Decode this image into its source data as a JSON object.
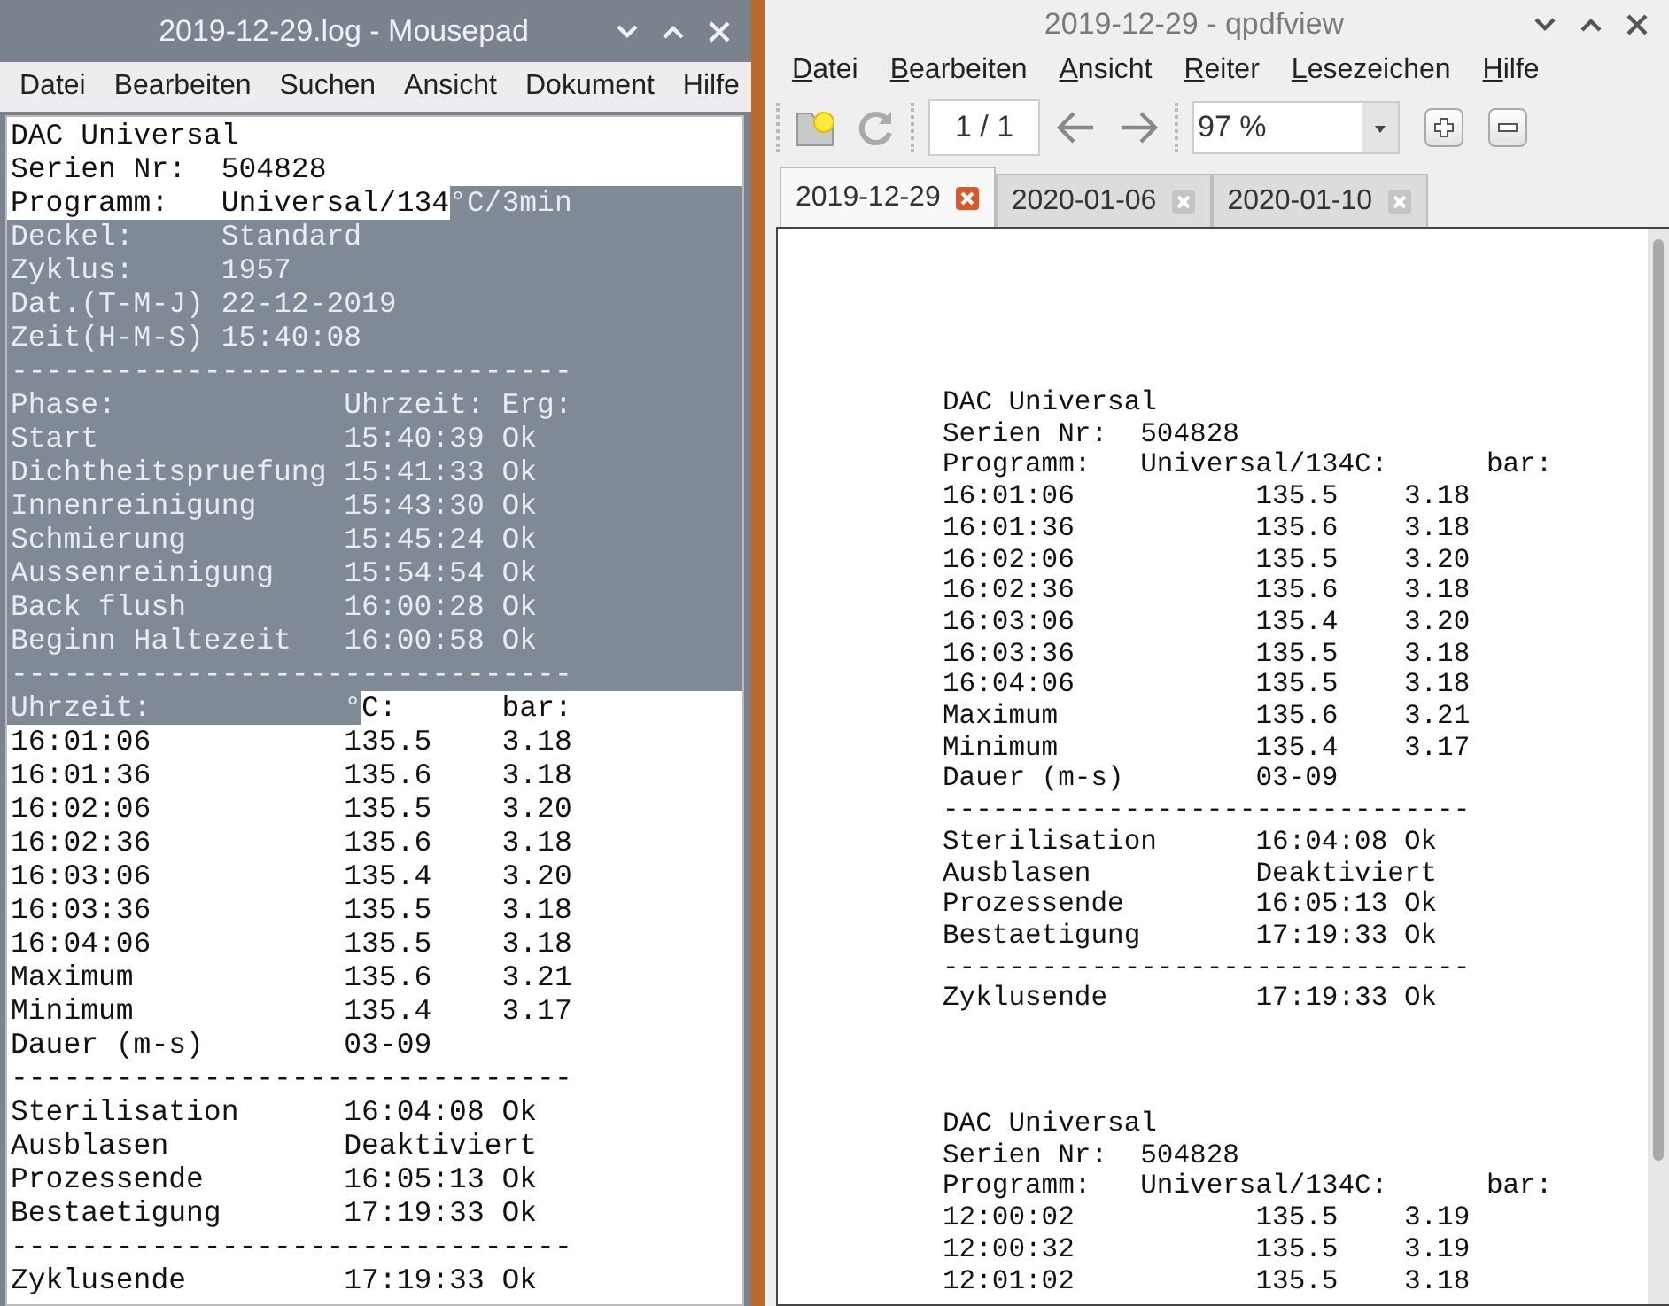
{
  "editor_window": {
    "title": "2019-12-29.log - Mousepad",
    "menu": [
      "Datei",
      "Bearbeiten",
      "Suchen",
      "Ansicht",
      "Dokument",
      "Hilfe"
    ],
    "lines": [
      {
        "parts": [
          {
            "text": "DAC Universal",
            "selected": false
          }
        ]
      },
      {
        "parts": [
          {
            "text": "Serien Nr:  504828",
            "selected": false
          }
        ]
      },
      {
        "parts": [
          {
            "text": "Programm:   Universal/134",
            "selected": false
          },
          {
            "text": "°C/3min",
            "selected": true
          }
        ]
      },
      {
        "parts": [
          {
            "text": "Deckel:     Standard",
            "selected": true
          }
        ]
      },
      {
        "parts": [
          {
            "text": "Zyklus:     1957",
            "selected": true
          }
        ]
      },
      {
        "parts": [
          {
            "text": "Dat.(T-M-J) 22-12-2019",
            "selected": true
          }
        ]
      },
      {
        "parts": [
          {
            "text": "Zeit(H-M-S) 15:40:08",
            "selected": true
          }
        ]
      },
      {
        "parts": [
          {
            "text": "--------------------------------",
            "selected": true
          }
        ]
      },
      {
        "parts": [
          {
            "text": "Phase:             Uhrzeit: Erg:",
            "selected": true
          }
        ]
      },
      {
        "parts": [
          {
            "text": "Start              15:40:39 Ok",
            "selected": true
          }
        ]
      },
      {
        "parts": [
          {
            "text": "Dichtheitspruefung 15:41:33 Ok",
            "selected": true
          }
        ]
      },
      {
        "parts": [
          {
            "text": "Innenreinigung     15:43:30 Ok",
            "selected": true
          }
        ]
      },
      {
        "parts": [
          {
            "text": "Schmierung         15:45:24 Ok",
            "selected": true
          }
        ]
      },
      {
        "parts": [
          {
            "text": "Aussenreinigung    15:54:54 Ok",
            "selected": true
          }
        ]
      },
      {
        "parts": [
          {
            "text": "Back flush         16:00:28 Ok",
            "selected": true
          }
        ]
      },
      {
        "parts": [
          {
            "text": "Beginn Haltezeit   16:00:58 Ok",
            "selected": true
          }
        ]
      },
      {
        "parts": [
          {
            "text": "--------------------------------",
            "selected": true
          }
        ]
      },
      {
        "parts": [
          {
            "text": "Uhrzeit:           °",
            "selected": true
          },
          {
            "text": "C:      bar:",
            "selected": false
          }
        ]
      },
      {
        "parts": [
          {
            "text": "16:01:06           135.5    3.18",
            "selected": false
          }
        ]
      },
      {
        "parts": [
          {
            "text": "16:01:36           135.6    3.18",
            "selected": false
          }
        ]
      },
      {
        "parts": [
          {
            "text": "16:02:06           135.5    3.20",
            "selected": false
          }
        ]
      },
      {
        "parts": [
          {
            "text": "16:02:36           135.6    3.18",
            "selected": false
          }
        ]
      },
      {
        "parts": [
          {
            "text": "16:03:06           135.4    3.20",
            "selected": false
          }
        ]
      },
      {
        "parts": [
          {
            "text": "16:03:36           135.5    3.18",
            "selected": false
          }
        ]
      },
      {
        "parts": [
          {
            "text": "16:04:06           135.5    3.18",
            "selected": false
          }
        ]
      },
      {
        "parts": [
          {
            "text": "Maximum            135.6    3.21",
            "selected": false
          }
        ]
      },
      {
        "parts": [
          {
            "text": "Minimum            135.4    3.17",
            "selected": false
          }
        ]
      },
      {
        "parts": [
          {
            "text": "Dauer (m-s)        03-09",
            "selected": false
          }
        ]
      },
      {
        "parts": [
          {
            "text": "--------------------------------",
            "selected": false
          }
        ]
      },
      {
        "parts": [
          {
            "text": "Sterilisation      16:04:08 Ok",
            "selected": false
          }
        ]
      },
      {
        "parts": [
          {
            "text": "Ausblasen          Deaktiviert",
            "selected": false
          }
        ]
      },
      {
        "parts": [
          {
            "text": "Prozessende        16:05:13 Ok",
            "selected": false
          }
        ]
      },
      {
        "parts": [
          {
            "text": "Bestaetigung       17:19:33 Ok",
            "selected": false
          }
        ]
      },
      {
        "parts": [
          {
            "text": "--------------------------------",
            "selected": false
          }
        ]
      },
      {
        "parts": [
          {
            "text": "Zyklusende         17:19:33 Ok",
            "selected": false
          }
        ]
      }
    ]
  },
  "viewer_window": {
    "title": "2019-12-29 - qpdfview",
    "menu": [
      "Datei",
      "Bearbeiten",
      "Ansicht",
      "Reiter",
      "Lesezeichen",
      "Hilfe"
    ],
    "page_field": "1 / 1",
    "zoom_field": "97 %",
    "tabs": [
      {
        "label": "2019-12-29",
        "selected": true
      },
      {
        "label": "2020-01-06",
        "selected": false
      },
      {
        "label": "2020-01-10",
        "selected": false
      }
    ],
    "blocks": [
      {
        "lines": [
          "DAC Universal",
          "Serien Nr:  504828",
          "Programm:   Universal/134C:      bar:",
          "16:01:06           135.5    3.18",
          "16:01:36           135.6    3.18",
          "16:02:06           135.5    3.20",
          "16:02:36           135.6    3.18",
          "16:03:06           135.4    3.20",
          "16:03:36           135.5    3.18",
          "16:04:06           135.5    3.18",
          "Maximum            135.6    3.21",
          "Minimum            135.4    3.17",
          "Dauer (m-s)        03-09",
          "--------------------------------",
          "Sterilisation      16:04:08 Ok",
          "Ausblasen          Deaktiviert",
          "Prozessende        16:05:13 Ok",
          "Bestaetigung       17:19:33 Ok",
          "--------------------------------",
          "Zyklusende         17:19:33 Ok"
        ]
      },
      {
        "lines": [
          "DAC Universal",
          "Serien Nr:  504828",
          "Programm:   Universal/134C:      bar:",
          "12:00:02           135.5    3.19",
          "12:00:32           135.5    3.19",
          "12:01:02           135.5    3.18"
        ]
      }
    ]
  }
}
